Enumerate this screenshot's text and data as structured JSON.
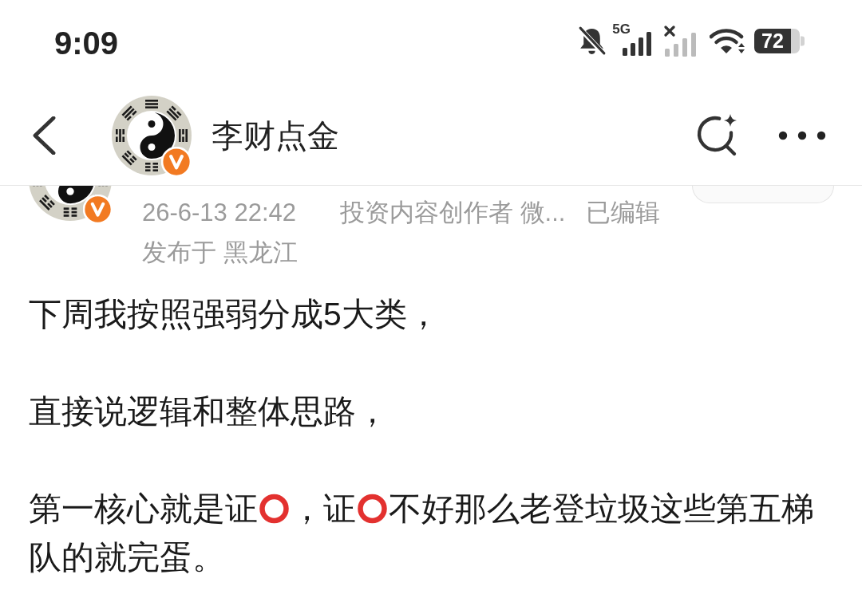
{
  "status_bar": {
    "time": "9:09",
    "network": "5G",
    "battery": "72"
  },
  "header": {
    "title": "李财点金",
    "avatar_verified": true
  },
  "post": {
    "avatar_verified": true,
    "timestamp": "26-6-13 22:42",
    "source": "投资内容创作者 微...",
    "edited": "已编辑",
    "location": "发布于 黑龙江",
    "paragraphs": [
      {
        "parts": [
          {
            "kind": "text",
            "text": "下周我按照强弱分成5大类，"
          }
        ]
      },
      {
        "parts": [
          {
            "kind": "text",
            "text": "直接说逻辑和整体思路，"
          }
        ]
      },
      {
        "parts": [
          {
            "kind": "text",
            "text": "第一核心就是证"
          },
          {
            "kind": "emoji"
          },
          {
            "kind": "text",
            "text": "，证"
          },
          {
            "kind": "emoji"
          },
          {
            "kind": "text",
            "text": "不好那么老登垃圾这些第五梯"
          },
          {
            "kind": "text",
            "text": "队的就完蛋。"
          }
        ]
      }
    ]
  }
}
